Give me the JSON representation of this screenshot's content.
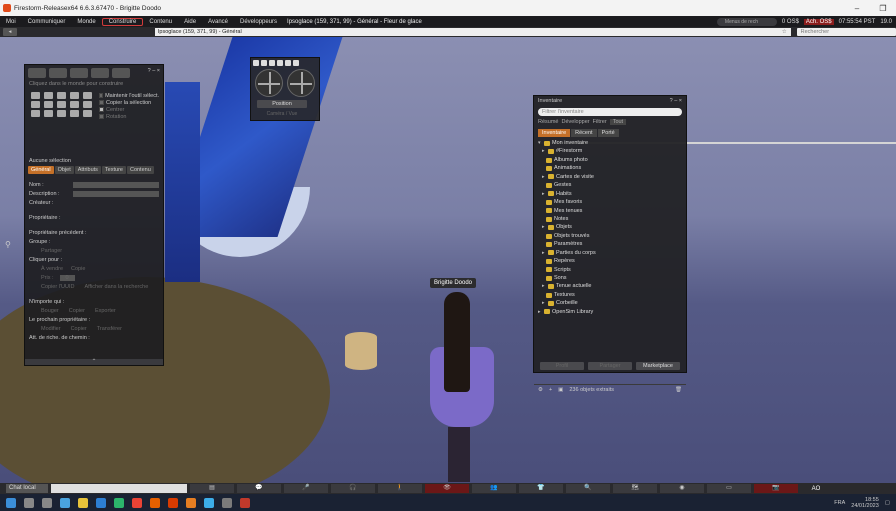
{
  "window": {
    "title": "Firestorm-Releasex64 6.6.3.67470 - Brigitte Doodo",
    "controls": [
      "–",
      "❐"
    ]
  },
  "menu": {
    "items": [
      "Moi",
      "Communiquer",
      "Monde",
      "Construire",
      "Contenu",
      "Aide",
      "Avancé",
      "Développeurs"
    ],
    "location": "Ipsoglace (159, 371, 99) - Général - Fleur de glace",
    "search_placeholder": "Menus de rech",
    "balance": "0 OS$",
    "buy_label": "Ach. OS$",
    "time": "07:55:54 PST",
    "fps": "19.0"
  },
  "nav": {
    "address": "Ipsoglace (159, 371, 99) - Général",
    "search_placeholder": "Rechercher"
  },
  "build": {
    "title_controls": "? – ×",
    "hint": "Cliquez dans le monde pour construire",
    "options": [
      "Maintenir l'outil sélect.",
      "Copier la sélection",
      "Centrer",
      "Rotation"
    ],
    "no_selection": "Aucune sélection",
    "tabs": [
      "Général",
      "Objet",
      "Attributs",
      "Texture",
      "Contenu"
    ],
    "fields": [
      "Nom :",
      "Description :",
      "Créateur :",
      "Propriétaire :",
      "Propriétaire précédent :",
      "Groupe :"
    ],
    "share_label": "Partager",
    "click_label": "Cliquer pour :",
    "for_sale_label": "À vendre",
    "copy_label": "Copie",
    "price_label": "Prix :",
    "price_value": "0",
    "show_search_label": "Afficher dans la recherche",
    "copy_keys_label": "Copier l'UUID",
    "anyone_label": "N'importe qui :",
    "next_owner_label": "Le prochain propriétaire :",
    "perms": [
      "Bouger",
      "Copier",
      "Exporter",
      "Modifier",
      "Copier",
      "Transférer"
    ],
    "click_actions_label": "Att. de riche. de chemin :"
  },
  "camera": {
    "position_label": "Position",
    "view_label": "Caméra / Vue"
  },
  "inventory": {
    "title": "Inventaire",
    "controls": "? – ×",
    "filter_placeholder": "Filtrer l'inventaire",
    "toolbar": [
      "Résumé",
      "Développer",
      "Filtrer",
      "Tout"
    ],
    "tabs": [
      "Inventaire",
      "Récent",
      "Porté"
    ],
    "root": "Mon inventaire",
    "folders": [
      "#Firestorm",
      "Albums photo",
      "Animations",
      "Cartes de visite",
      "Gestes",
      "Habits",
      "Mes favoris",
      "Mes tenues",
      "Notes",
      "Objets",
      "Objets trouvés",
      "Paramètres",
      "Parties du corps",
      "Repères",
      "Scripts",
      "Sons",
      "Tenue actuelle",
      "Textures",
      "Corbeille",
      "OpenSim Library"
    ],
    "status": "236 objets extraits",
    "buttons": [
      "Profil",
      "Partager",
      "Marketplace"
    ]
  },
  "scene": {
    "nametag": "Brigitte Doodo"
  },
  "toolbar": {
    "chat_label": "Chat local",
    "ao_label": "AO"
  },
  "taskbar": {
    "lang": "FRA",
    "time": "18:55",
    "date": "24/01/2023"
  },
  "colors": {
    "accent": "#c47028",
    "menu_bg": "#1b1b1e",
    "panel_bg": "#222225",
    "sky": "#8b8fb2",
    "highlight": "#8a1d1d"
  }
}
